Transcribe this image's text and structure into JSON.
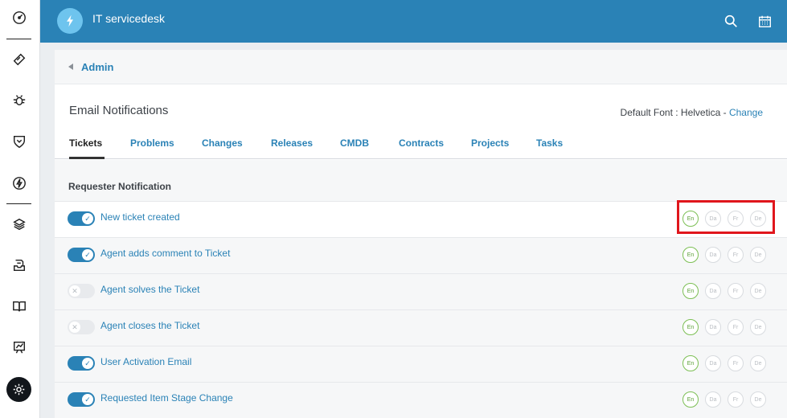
{
  "sidebar": {
    "items": [
      {
        "icon": "dashboard-icon"
      },
      {
        "icon": "ticket-icon"
      },
      {
        "icon": "bug-icon"
      },
      {
        "icon": "shield-icon"
      },
      {
        "icon": "lightning-icon"
      },
      {
        "icon": "layers-icon"
      },
      {
        "icon": "inbox-icon"
      },
      {
        "icon": "book-icon"
      },
      {
        "icon": "report-icon"
      },
      {
        "icon": "gear-icon"
      }
    ]
  },
  "header": {
    "app_title": "IT servicedesk",
    "logo_icon": "lightning-icon",
    "actions": [
      "search-icon",
      "calendar-icon"
    ],
    "color": "#2a82b6"
  },
  "breadcrumb": {
    "label": "Admin"
  },
  "page": {
    "title": "Email Notifications",
    "font_label": "Default Font : ",
    "font_value": "Helvetica",
    "font_separator": " - ",
    "font_change": "Change"
  },
  "tabs": [
    {
      "label": "Tickets",
      "active": true
    },
    {
      "label": "Problems",
      "active": false
    },
    {
      "label": "Changes",
      "active": false
    },
    {
      "label": "Releases",
      "active": false
    },
    {
      "label": "CMDB",
      "active": false
    },
    {
      "label": "Contracts",
      "active": false
    },
    {
      "label": "Projects",
      "active": false
    },
    {
      "label": "Tasks",
      "active": false
    }
  ],
  "section": {
    "title": "Requester Notification",
    "rows": [
      {
        "label": "New ticket created",
        "enabled": true
      },
      {
        "label": "Agent adds comment to Ticket",
        "enabled": true
      },
      {
        "label": "Agent solves the Ticket",
        "enabled": false
      },
      {
        "label": "Agent closes the Ticket",
        "enabled": false
      },
      {
        "label": "User Activation Email",
        "enabled": true
      },
      {
        "label": "Requested Item Stage Change",
        "enabled": true
      }
    ]
  },
  "languages": [
    {
      "code": "En",
      "active": true
    },
    {
      "code": "Da",
      "active": false
    },
    {
      "code": "Fr",
      "active": false
    },
    {
      "code": "De",
      "active": false
    }
  ],
  "colors": {
    "accent": "#2a82b6",
    "language_active": "#7cbf54",
    "highlight_frame": "#e0161c"
  }
}
